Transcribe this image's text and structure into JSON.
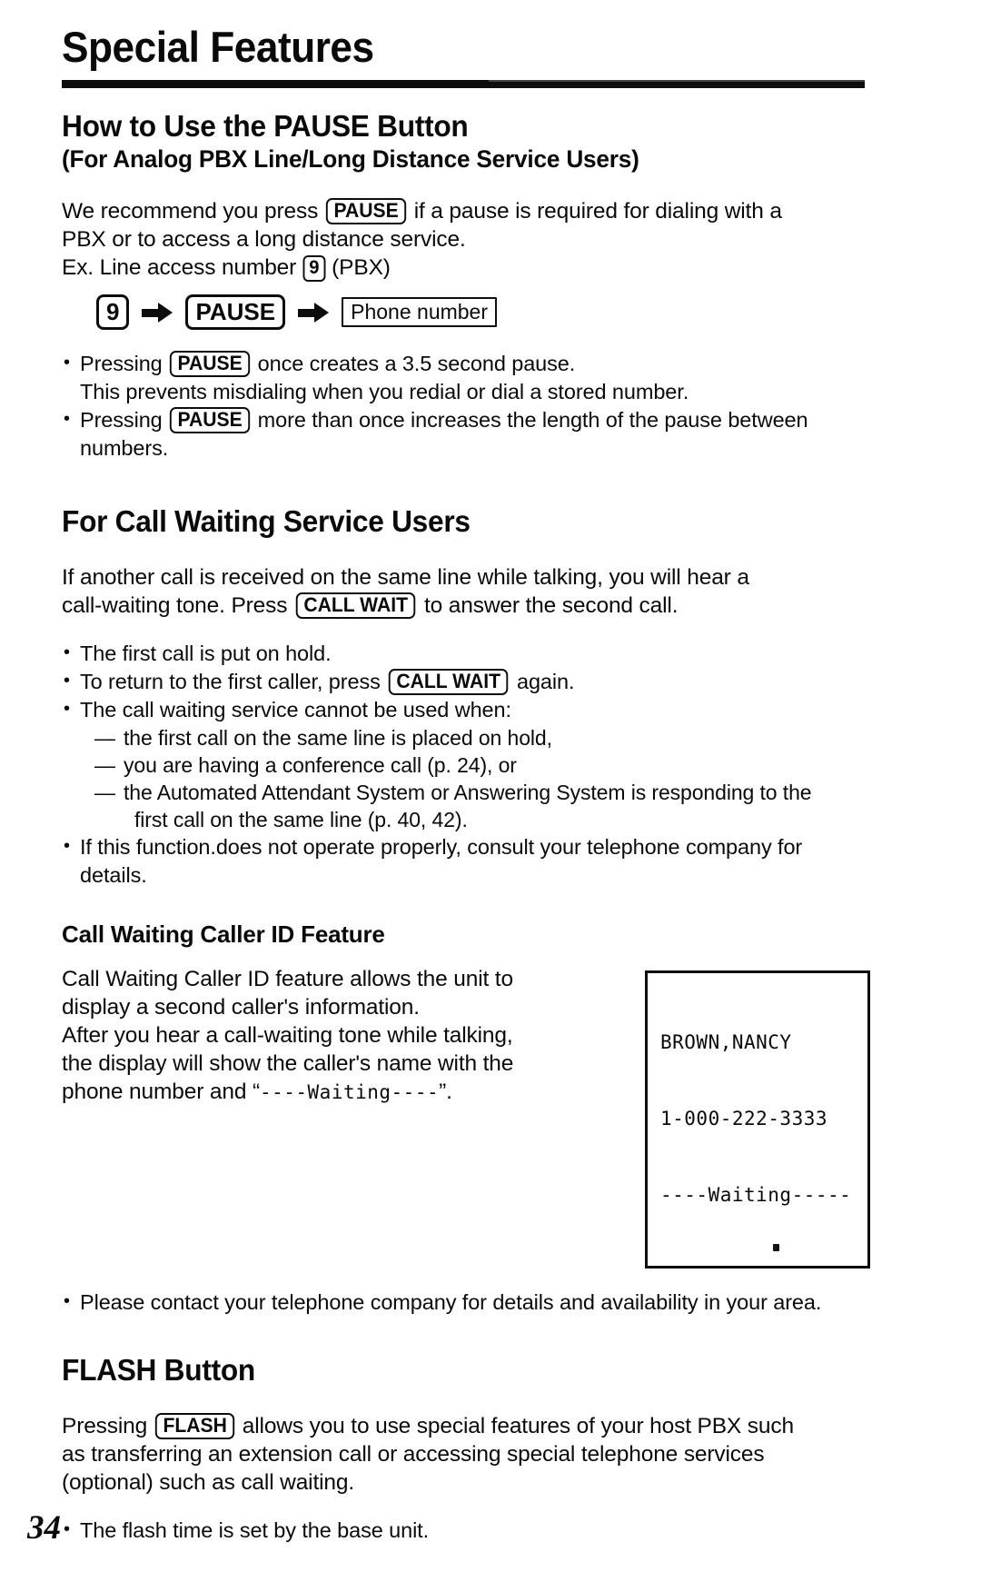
{
  "document": {
    "page_title": "Special Features",
    "page_number": "34"
  },
  "pause_section": {
    "heading": "How to Use the PAUSE Button",
    "subheading": "(For Analog PBX Line/Long Distance Service Users)",
    "intro_1a": "We recommend you press ",
    "key_pause": "PAUSE",
    "intro_1b": " if a pause is required for dialing with a",
    "intro_2": "PBX or to access a long distance service.",
    "example_a": "Ex. Line access number ",
    "key_nine": "9",
    "example_b": " (PBX)",
    "sequence": {
      "step1": "9",
      "step2": "PAUSE",
      "step3": "Phone number"
    },
    "bullets": [
      {
        "pre": "Pressing ",
        "key": "PAUSE",
        "post": " once creates a 3.5 second pause."
      },
      {
        "cont": "This prevents misdialing when you redial or dial a stored number."
      },
      {
        "pre": "Pressing ",
        "key": "PAUSE",
        "post": " more than once increases the length of the pause between"
      },
      {
        "cont": "numbers."
      }
    ]
  },
  "call_waiting_section": {
    "heading": "For Call Waiting Service Users",
    "intro_1": "If another call is received on the same line while talking, you will hear a",
    "intro_2a": "call-waiting tone. Press ",
    "key_call_wait": "CALL WAIT",
    "intro_2b": " to answer the second call.",
    "bullet_1": "The first call is put on hold.",
    "bullet_2a": "To return to the first caller, press ",
    "bullet_2_key": "CALL WAIT",
    "bullet_2b": " again.",
    "bullet_3": "The call waiting service cannot be used when:",
    "dash_items": [
      "the first call on the same line is placed on hold,",
      "you are having a conference call (p. 24), or"
    ],
    "dash_item_3_line1": "the Automated Attendant System or Answering System is responding to the",
    "dash_item_3_line2": "first call on the same line (p. 40, 42).",
    "bullet_4a": "If this function.does not operate properly, consult your telephone company for",
    "bullet_4b": "details."
  },
  "caller_id_section": {
    "heading": "Call Waiting Caller ID Feature",
    "para_line_1": "Call Waiting Caller ID feature allows the unit to",
    "para_line_2": "display a second caller's information.",
    "para_line_3": "After you hear a call-waiting tone while talking,",
    "para_line_4": "the display will show the caller's name with the",
    "para_line_5_a": "phone number and “",
    "para_line_5_mono": "----Waiting----",
    "para_line_5_b": "”.",
    "lcd_display": {
      "line_1": "BROWN,NANCY",
      "line_2": "1-000-222-3333",
      "line_3": "----Waiting-----"
    },
    "bullet": "Please contact your telephone company for details and availability in your area."
  },
  "flash_section": {
    "heading": "FLASH Button",
    "para_1a": "Pressing ",
    "key_flash": "FLASH",
    "para_1b": " allows you to use special features of your host PBX such",
    "para_2": "as transferring an extension call or accessing special telephone services",
    "para_3": "(optional) such as call waiting.",
    "bullet": "The flash time is set by the base unit."
  }
}
